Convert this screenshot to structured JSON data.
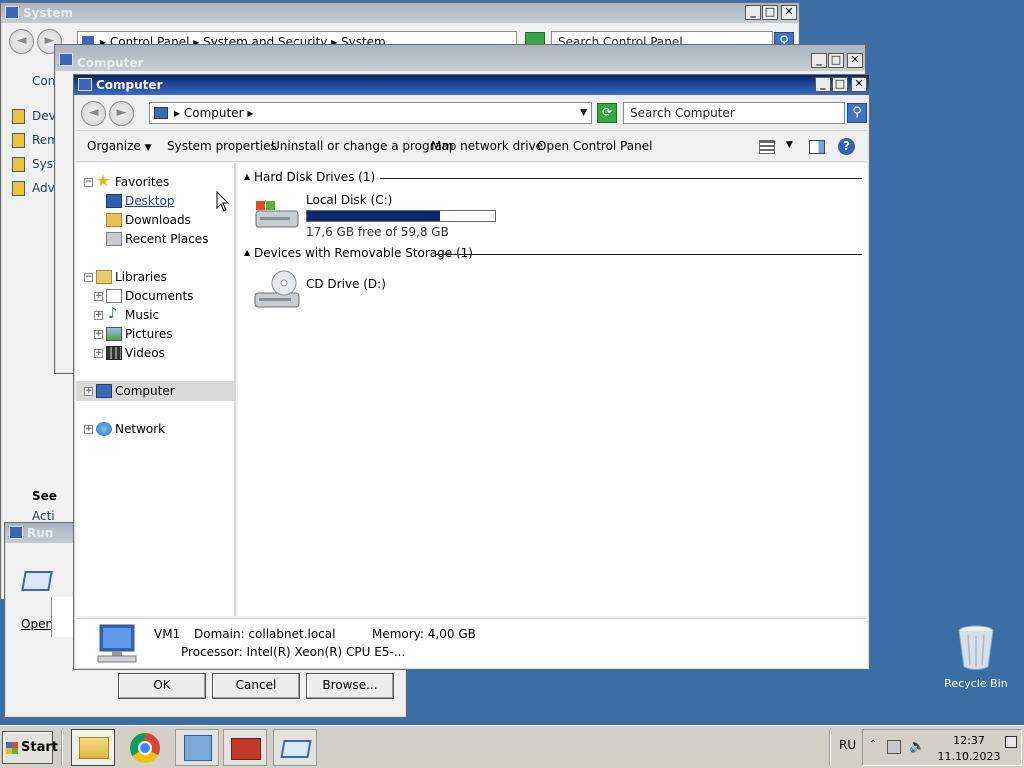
{
  "desktop": {
    "recycle_bin": "Recycle Bin"
  },
  "system_window": {
    "title": "System",
    "address": {
      "segments": [
        "Control Panel",
        "System and Security",
        "System"
      ]
    },
    "search_placeholder": "Search Control Panel",
    "left_links": {
      "home_partial": "Con",
      "items": [
        "Dev",
        "Rem",
        "Syst",
        "Adv"
      ]
    },
    "see_also_partial": "See",
    "see_also_item_partial": "Acti"
  },
  "run_dialog": {
    "title_partial": "Run",
    "open_label_partial": "Open",
    "ok": "OK",
    "cancel": "Cancel",
    "browse": "Browse..."
  },
  "computer_back_window": {
    "title": "Computer"
  },
  "computer_window": {
    "title": "Computer",
    "address": {
      "segment": "Computer"
    },
    "search_placeholder": "Search Computer",
    "commands": [
      "Organize",
      "System properties",
      "Uninstall or change a program",
      "Map network drive",
      "Open Control Panel"
    ],
    "nav": {
      "favorites": "Favorites",
      "favorites_items": [
        "Desktop",
        "Downloads",
        "Recent Places"
      ],
      "libraries": "Libraries",
      "libraries_items": [
        "Documents",
        "Music",
        "Pictures",
        "Videos"
      ],
      "computer": "Computer",
      "network": "Network"
    },
    "groups": {
      "hdd": "Hard Disk Drives (1)",
      "removable": "Devices with Removable Storage (1)"
    },
    "drives": {
      "local_disk": {
        "name": "Local Disk (C:)",
        "free_text": "17,6 GB free of 59,8 GB",
        "used_fraction": 0.706
      },
      "cd_drive": {
        "name": "CD Drive (D:)"
      }
    },
    "details": {
      "name": "VM1",
      "domain": "Domain: collabnet.local",
      "memory": "Memory: 4,00 GB",
      "processor": "Processor: Intel(R) Xeon(R) CPU E5-..."
    }
  },
  "taskbar": {
    "start": "Start",
    "language": "RU",
    "time": "12:37",
    "date": "11.10.2023"
  },
  "colors": {
    "desktop": "#3a6ea5",
    "active_title": "#0a246a",
    "disk_bar": "#0c2a6b"
  }
}
